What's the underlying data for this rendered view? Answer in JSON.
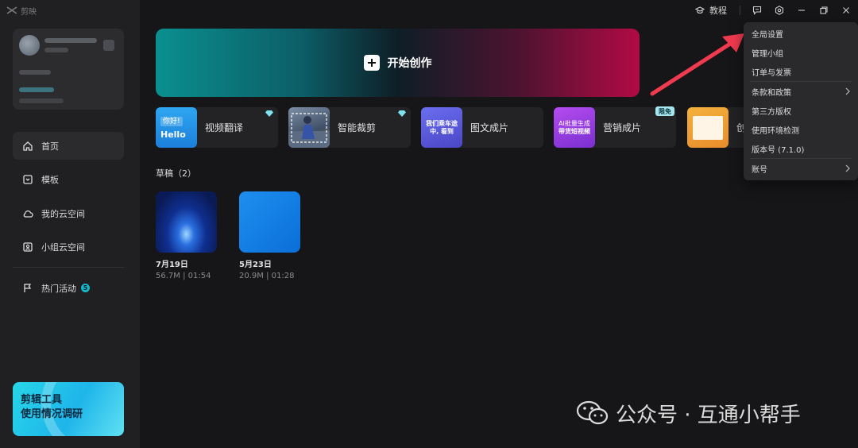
{
  "app": {
    "brand": "剪映"
  },
  "sidebar": {
    "profile": {
      "name_blurred": "",
      "status_blurred": ""
    },
    "nav": [
      {
        "label": "首页",
        "icon": "home-icon",
        "active": true
      },
      {
        "label": "模板",
        "icon": "template-icon",
        "active": false
      },
      {
        "label": "我的云空间",
        "icon": "cloud-icon",
        "active": false
      },
      {
        "label": "小组云空间",
        "icon": "team-cloud-icon",
        "active": false
      },
      {
        "label": "热门活动",
        "icon": "flag-icon",
        "active": false,
        "badge": "5"
      }
    ],
    "survey": {
      "line1": "剪辑工具",
      "line2": "使用情况调研"
    }
  },
  "titlebar": {
    "tutorial": "教程",
    "icons": [
      "feedback-icon",
      "settings-icon",
      "minimize-icon",
      "restore-icon",
      "close-icon"
    ]
  },
  "create": {
    "label": "开始创作"
  },
  "tools": [
    {
      "label": "视频翻译",
      "thumb_text_top": "你好!",
      "thumb_text_bottom": "Hello",
      "gem": true
    },
    {
      "label": "智能裁剪",
      "gem": true
    },
    {
      "label": "图文成片",
      "thumb_text_top": "我们乘车途",
      "thumb_text_bottom": "中, 看到"
    },
    {
      "label": "营销成片",
      "thumb_text_top": "AI批量生成",
      "thumb_text_bottom": "带货短视频",
      "tag": "限免"
    },
    {
      "label": "创"
    }
  ],
  "drafts": {
    "title": "草稿（2）",
    "items": [
      {
        "date": "7月19日",
        "meta": "56.7M | 01:54"
      },
      {
        "date": "5月23日",
        "meta": "20.9M | 01:28"
      }
    ]
  },
  "menu": {
    "items": [
      {
        "label": "全局设置",
        "arrow": false
      },
      {
        "label": "管理小组",
        "arrow": false
      },
      {
        "label": "订单与发票",
        "arrow": false
      },
      {
        "sep": true
      },
      {
        "label": "条款和政策",
        "arrow": true
      },
      {
        "label": "第三方版权",
        "arrow": false
      },
      {
        "label": "使用环境检测",
        "arrow": false
      },
      {
        "label": "版本号 (7.1.0)",
        "arrow": false
      },
      {
        "sep": true
      },
      {
        "label": "账号",
        "arrow": true
      }
    ]
  },
  "watermark": {
    "text": "公众号 · 互通小帮手"
  },
  "colors": {
    "accent": "#14b8c8",
    "annotation_arrow": "#f03a4f",
    "background": "#161618",
    "sidebar": "#202022"
  }
}
